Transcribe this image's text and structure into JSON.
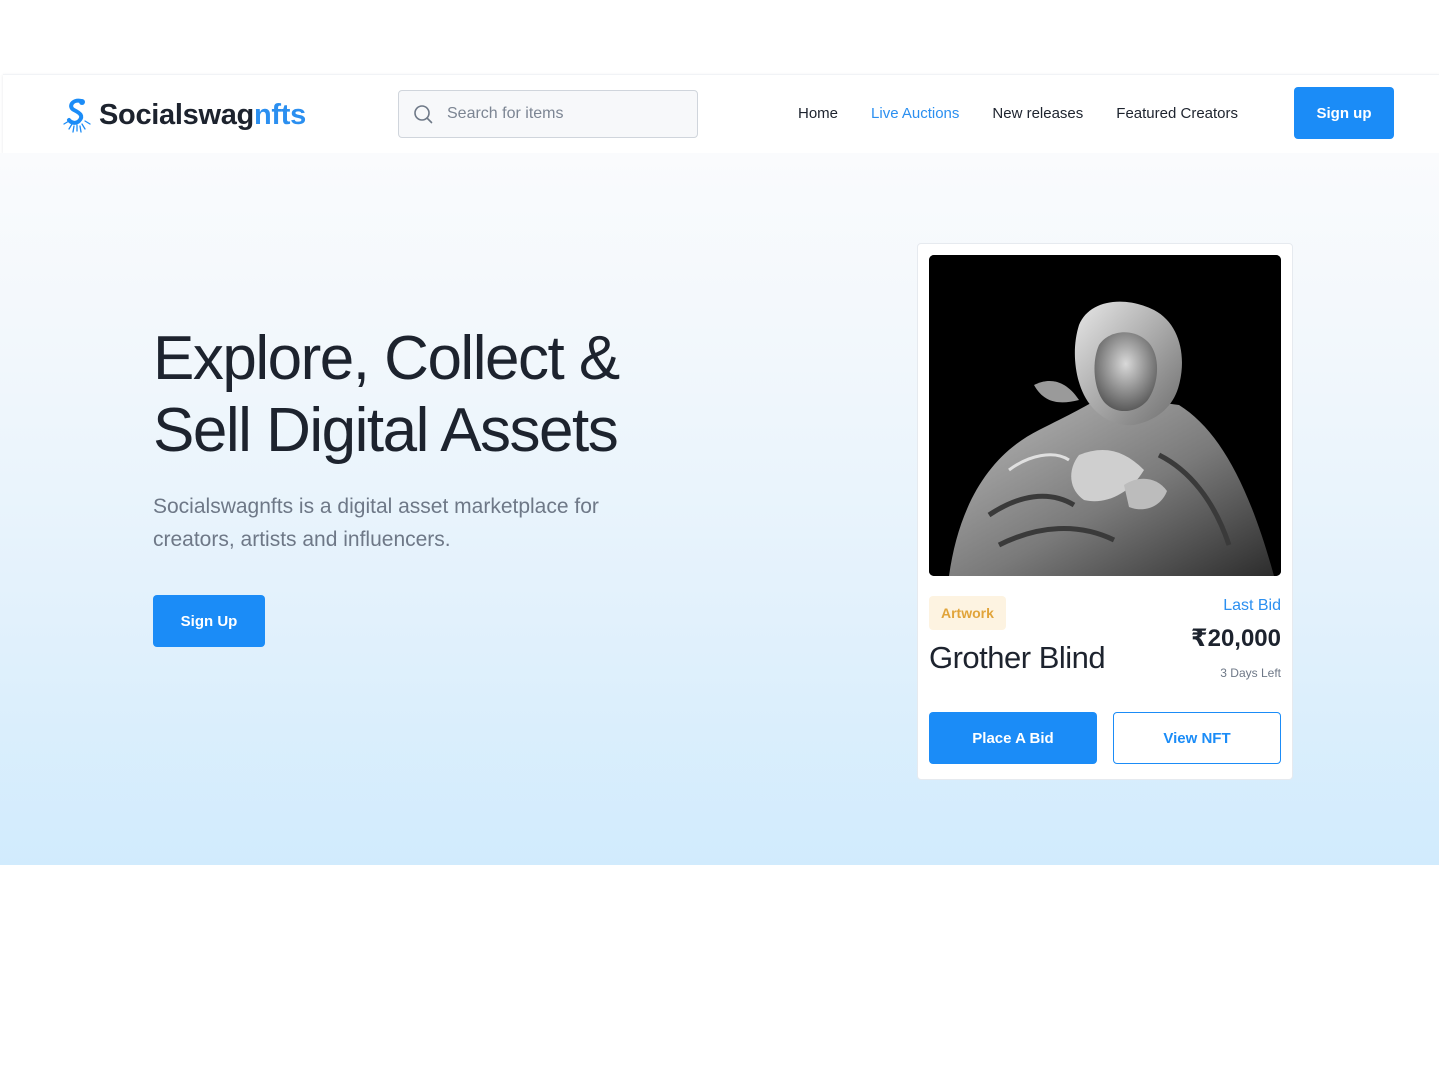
{
  "brand": {
    "name_main": "Socialswag",
    "name_accent": "nfts",
    "logo_icon": "spiral-s-logo-icon",
    "accent_color": "#2b8ff0"
  },
  "search": {
    "placeholder": "Search for items",
    "value": "",
    "icon": "search-icon"
  },
  "nav": {
    "items": [
      {
        "label": "Home",
        "active": false
      },
      {
        "label": "Live Auctions",
        "active": true
      },
      {
        "label": "New releases",
        "active": false
      },
      {
        "label": "Featured Creators",
        "active": false
      }
    ],
    "signup_label": "Sign up"
  },
  "hero": {
    "title_line1": "Explore, Collect &",
    "title_line2": "Sell Digital Assets",
    "subtitle": "Socialswagnfts is a digital asset marketplace for creators, artists and influencers.",
    "cta_label": "Sign Up"
  },
  "card": {
    "image_alt": "marble-statue-image",
    "tag": "Artwork",
    "title": "Grother Blind",
    "last_bid_label": "Last Bid",
    "last_bid_value": "₹20,000",
    "time_left": "3 Days Left",
    "place_bid_label": "Place A Bid",
    "view_label": "View NFT"
  },
  "colors": {
    "primary": "#1b8cf7",
    "text_dark": "#1d232e",
    "text_muted": "#6e7887",
    "tag_bg": "#fdf3e1",
    "tag_text": "#e1a43a"
  }
}
